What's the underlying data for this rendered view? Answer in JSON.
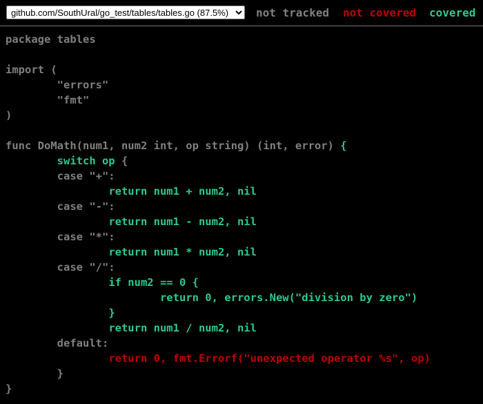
{
  "file_selector": {
    "selected": "github.com/SouthUral/go_test/tables/tables.go (87.5%)"
  },
  "legend": {
    "not_tracked": "not tracked",
    "not_covered": "not covered",
    "covered": "covered"
  },
  "colors": {
    "background": "#000000",
    "not_tracked": "#808080",
    "not_covered": "#c00000",
    "covered": "#2cc98f"
  },
  "code_lines": [
    [
      {
        "t": "package tables",
        "s": "plain"
      }
    ],
    [],
    [
      {
        "t": "import (",
        "s": "plain"
      }
    ],
    [
      {
        "t": "\t\"errors\"",
        "s": "plain"
      }
    ],
    [
      {
        "t": "\t\"fmt\"",
        "s": "plain"
      }
    ],
    [
      {
        "t": ")",
        "s": "plain"
      }
    ],
    [],
    [
      {
        "t": "func DoMath(num1, num2 int, op string) (int, error) ",
        "s": "plain"
      },
      {
        "t": "{",
        "s": "covered"
      }
    ],
    [
      {
        "t": "\t",
        "s": "plain"
      },
      {
        "t": "switch op",
        "s": "covered"
      },
      {
        "t": " {",
        "s": "plain"
      }
    ],
    [
      {
        "t": "\tcase \"+\":",
        "s": "plain"
      }
    ],
    [
      {
        "t": "\t\t",
        "s": "plain"
      },
      {
        "t": "return num1 + num2, nil",
        "s": "covered"
      }
    ],
    [
      {
        "t": "\tcase \"-\":",
        "s": "plain"
      }
    ],
    [
      {
        "t": "\t\t",
        "s": "plain"
      },
      {
        "t": "return num1 - num2, nil",
        "s": "covered"
      }
    ],
    [
      {
        "t": "\tcase \"*\":",
        "s": "plain"
      }
    ],
    [
      {
        "t": "\t\t",
        "s": "plain"
      },
      {
        "t": "return num1 * num2, nil",
        "s": "covered"
      }
    ],
    [
      {
        "t": "\tcase \"/\":",
        "s": "plain"
      }
    ],
    [
      {
        "t": "\t\t",
        "s": "plain"
      },
      {
        "t": "if num2 == 0 {",
        "s": "covered"
      }
    ],
    [
      {
        "t": "\t\t\t",
        "s": "plain"
      },
      {
        "t": "return 0, errors.New(\"division by zero\")",
        "s": "covered"
      }
    ],
    [
      {
        "t": "\t\t",
        "s": "plain"
      },
      {
        "t": "}",
        "s": "covered"
      }
    ],
    [
      {
        "t": "\t\t",
        "s": "plain"
      },
      {
        "t": "return num1 / num2, nil",
        "s": "covered"
      }
    ],
    [
      {
        "t": "\tdefault:",
        "s": "plain"
      }
    ],
    [
      {
        "t": "\t\t",
        "s": "plain"
      },
      {
        "t": "return 0, fmt.Errorf(\"unexpected operator %s\", op)",
        "s": "not-covered"
      }
    ],
    [
      {
        "t": "\t}",
        "s": "plain"
      }
    ],
    [
      {
        "t": "}",
        "s": "plain"
      }
    ]
  ]
}
